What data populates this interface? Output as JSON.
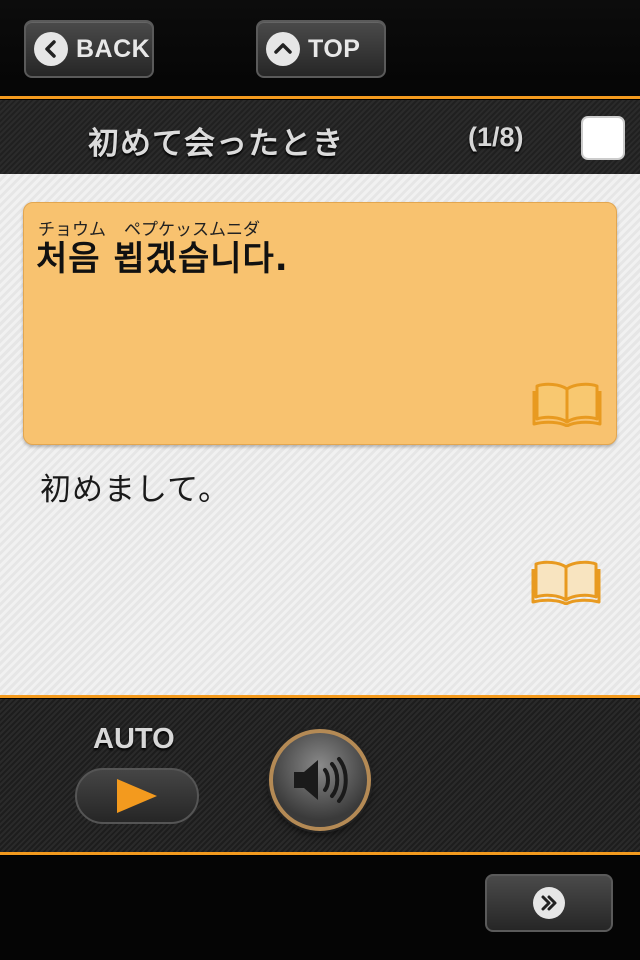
{
  "header": {
    "back_label": "BACK",
    "top_label": "TOP"
  },
  "title_bar": {
    "title": "初めて会ったとき",
    "counter": "(1/8)",
    "checkbox_checked": false
  },
  "card": {
    "reading_1": "チョウム",
    "reading_2": "ペプケッスムニダ",
    "korean": "처음  뵙겠습니다."
  },
  "translation": {
    "text": "初めまして。"
  },
  "controls": {
    "auto_label": "AUTO"
  },
  "icons": {
    "back": "chevron-left-icon",
    "top": "chevron-up-icon",
    "book": "book-icon",
    "play": "play-icon",
    "sound": "speaker-icon",
    "next": "double-chevron-right-icon"
  },
  "colors": {
    "accent": "#f39a1e",
    "card": "#f8c26f",
    "play": "#f39a1e"
  }
}
